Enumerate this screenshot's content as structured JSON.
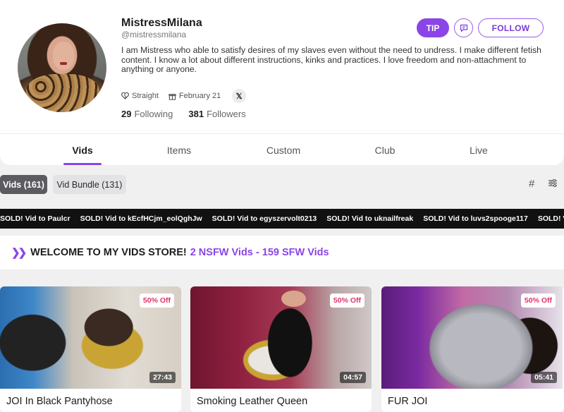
{
  "profile": {
    "name": "MistressMilana",
    "handle": "@mistressmilana",
    "bio": "I am Mistress who able to satisfy desires of my slaves even without the need to undress. I make different fetish content. I know a lot about different instructions, kinks and practices. I love freedom and non-attachment to anything or anyone.",
    "orientation": "Straight",
    "birthday": "February 21",
    "social_x": "𝕏",
    "following_count": "29",
    "following_label": "Following",
    "followers_count": "381",
    "followers_label": "Followers"
  },
  "actions": {
    "tip_label": "TIP",
    "follow_label": "FOLLOW"
  },
  "tabs": [
    {
      "label": "Vids",
      "active": true
    },
    {
      "label": "Items"
    },
    {
      "label": "Custom"
    },
    {
      "label": "Club"
    },
    {
      "label": "Live"
    }
  ],
  "filters": {
    "vids": "Vids (161)",
    "bundle": "Vid Bundle (131)"
  },
  "ticker": [
    "SOLD! Vid to Paulcr",
    "SOLD! Vid to kEcfHCjm_eolQghJw",
    "SOLD! Vid to egyszervolt0213",
    "SOLD! Vid to uknailfreak",
    "SOLD! Vid to luvs2spooge117",
    "SOLD! Vid to Darkm"
  ],
  "welcome": {
    "title": "WELCOME TO MY VIDS STORE!",
    "highlight": "2 NSFW Vids - 159 SFW Vids"
  },
  "videos": [
    {
      "title": "JOI In Black Pantyhose",
      "badge": "50% Off",
      "duration": "27:43"
    },
    {
      "title": "Smoking Leather Queen",
      "badge": "50% Off",
      "duration": "04:57"
    },
    {
      "title": "FUR JOI",
      "badge": "50% Off",
      "duration": "05:41"
    }
  ],
  "colors": {
    "accent": "#8b45e6",
    "sale_badge": "#e2336b",
    "ticker_bg": "#111111"
  }
}
